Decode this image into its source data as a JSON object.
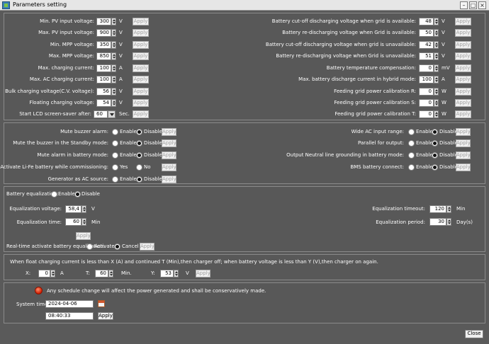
{
  "window": {
    "title": "Parameters setting",
    "minimize_glyph": "–",
    "maximize_glyph": "□",
    "close_glyph": "×"
  },
  "apply_label": "Apply",
  "close_label": "Close",
  "left_params": [
    {
      "label": "Min. PV input voltage:",
      "value": "300",
      "unit": "V"
    },
    {
      "label": "Max. PV input voltage:",
      "value": "900",
      "unit": "V"
    },
    {
      "label": "Min. MPP voltage:",
      "value": "350",
      "unit": "V"
    },
    {
      "label": "Max. MPP voltage:",
      "value": "850",
      "unit": "V"
    },
    {
      "label": "Max. charging current:",
      "value": "100",
      "unit": "A"
    },
    {
      "label": "Max. AC charging current:",
      "value": "100",
      "unit": "A"
    },
    {
      "label": "Bulk charging voltage(C.V. voltage):",
      "value": "56",
      "unit": "V"
    },
    {
      "label": "Floating charging voltage:",
      "value": "54",
      "unit": "V"
    },
    {
      "label": "Start LCD screen-saver after:",
      "value": "60",
      "unit": "Sec."
    }
  ],
  "right_params": [
    {
      "label": "Battery cut-off discharging voltage when grid is available:",
      "value": "48",
      "unit": "V"
    },
    {
      "label": "Battery re-discharging voltage when Grid is available:",
      "value": "50",
      "unit": "V"
    },
    {
      "label": "Battery cut-off discharging voltage when grid is unavailable:",
      "value": "42",
      "unit": "V"
    },
    {
      "label": "Battery re-discharging voltage when Grid is unavailable:",
      "value": "51",
      "unit": "V"
    },
    {
      "label": "Battery temperature compensation:",
      "value": "0",
      "unit": "mV"
    },
    {
      "label": "Max. battery discharge current in hybrid mode:",
      "value": "100",
      "unit": "A"
    },
    {
      "label": "Feeding grid power calibration R:",
      "value": "0",
      "unit": "W"
    },
    {
      "label": "Feeding grid power calibration S:",
      "value": "0",
      "unit": "W"
    },
    {
      "label": "Feeding grid power calibration T:",
      "value": "0",
      "unit": "W"
    }
  ],
  "left_toggles": [
    {
      "label": "Mute buzzer alarm:",
      "opt1": "Enable",
      "opt2": "Disable",
      "selected": 2
    },
    {
      "label": "Mute the buzzer in the Standby mode:",
      "opt1": "Enable",
      "opt2": "Disable",
      "selected": 2
    },
    {
      "label": "Mute alarm in battery mode:",
      "opt1": "Enable",
      "opt2": "Disable",
      "selected": 2
    },
    {
      "label": "Activate Li-Fe battery while commissioning:",
      "opt1": "Yes",
      "opt2": "No",
      "selected": 0
    },
    {
      "label": "Generator as AC source:",
      "opt1": "Enable",
      "opt2": "Disable",
      "selected": 2
    }
  ],
  "right_toggles": [
    {
      "label": "Wide AC input range:",
      "opt1": "Enable",
      "opt2": "Disable",
      "selected": 2
    },
    {
      "label": "Parallel for output:",
      "opt1": "Enable",
      "opt2": "Disable",
      "selected": 2
    },
    {
      "label": "Output Neutral line grounding in battery mode:",
      "opt1": "Enable",
      "opt2": "Disable",
      "selected": 2
    },
    {
      "label": "BMS battery connect:",
      "opt1": "Enable",
      "opt2": "Disable",
      "selected": 2
    }
  ],
  "equalization": {
    "label": "Battery equalization:",
    "enable": "Enable",
    "disable": "Disable",
    "selected": 2,
    "voltage_label": "Equalization voltage:",
    "voltage_value": "58,4",
    "voltage_unit": "V",
    "time_label": "Equalization time:",
    "time_value": "60",
    "time_unit": "Min",
    "timeout_label": "Equalization timeout:",
    "timeout_value": "120",
    "timeout_unit": "Min",
    "period_label": "Equalization period:",
    "period_value": "30",
    "period_unit": "Day(s)",
    "realtime_label": "Real-time activate battery equalization:",
    "activate": "Activate",
    "cancel": "Cancel",
    "realtime_selected": 2
  },
  "float_charging": {
    "description": "When float charging current is less than X (A) and continued T (Min),then charger off; when battery voltage is less than Y (V),then charger on again.",
    "x_label": "X:",
    "x_value": "0",
    "x_unit": "A",
    "t_label": "T:",
    "t_value": "60",
    "t_unit": "Min.",
    "y_label": "Y:",
    "y_value": "53",
    "y_unit": "V"
  },
  "system": {
    "warning": "Any schedule change will affect the power generated and shall be conservatively made.",
    "time_label": "System time:",
    "date": "2024-04-06",
    "time": "08:40:33"
  }
}
